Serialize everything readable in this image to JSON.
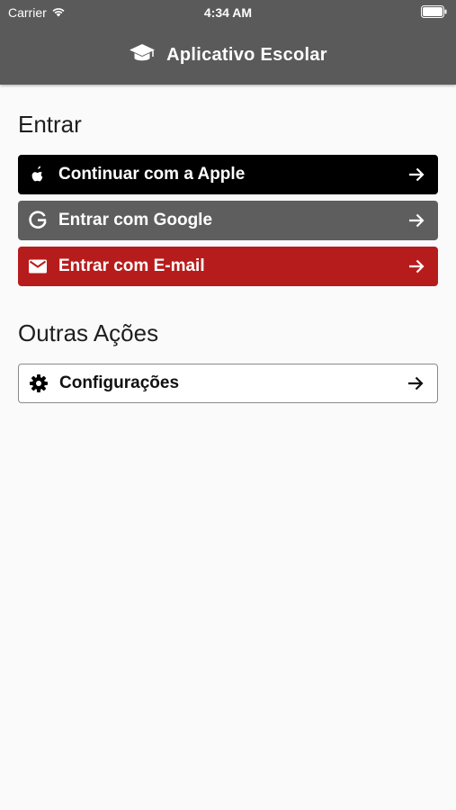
{
  "status_bar": {
    "carrier": "Carrier",
    "time": "4:34 AM",
    "wifi_icon": "wifi-icon",
    "battery_icon": "battery-icon"
  },
  "nav": {
    "title": "Aplicativo Escolar",
    "icon": "graduation-cap-icon",
    "background": "#5a5a5a"
  },
  "login_section": {
    "title": "Entrar",
    "buttons": [
      {
        "label": "Continuar com a Apple",
        "icon": "apple-icon",
        "background": "#000000"
      },
      {
        "label": "Entrar com Google",
        "icon": "google-icon",
        "background": "#5e5e5e"
      },
      {
        "label": "Entrar com E-mail",
        "icon": "mail-icon",
        "background": "#b71c1c"
      }
    ]
  },
  "other_section": {
    "title": "Outras Ações",
    "buttons": [
      {
        "label": "Configurações",
        "icon": "gear-icon",
        "background": "#ffffff"
      }
    ]
  },
  "arrow_icon": "arrow-right-icon"
}
